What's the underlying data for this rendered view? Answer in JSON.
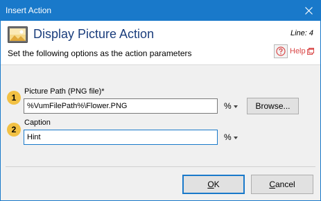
{
  "window": {
    "title": "Insert Action"
  },
  "header": {
    "title": "Display Picture Action",
    "line_info": "Line: 4",
    "subtitle": "Set the following options as the action parameters",
    "help_label": "Help"
  },
  "fields": [
    {
      "step": "1",
      "label": "Picture Path (PNG file)*",
      "value": "%VumFilePath%\\Flower.PNG",
      "var_label": "%"
    },
    {
      "step": "2",
      "label": "Caption",
      "value": "Hint",
      "var_label": "%"
    }
  ],
  "buttons": {
    "browse": "Browse...",
    "ok_prefix": "",
    "ok_hotkey": "O",
    "ok_suffix": "K",
    "cancel_prefix": "",
    "cancel_hotkey": "C",
    "cancel_suffix": "ancel"
  },
  "colors": {
    "titlebar": "#1979ca",
    "badge": "#f2c144",
    "help": "#d94646",
    "title_text": "#1a3d7c"
  },
  "icons": {
    "close": "close-icon",
    "picture": "picture-icon",
    "help": "help-question-icon",
    "external": "external-window-icon",
    "dropdown": "caret-down-icon"
  }
}
